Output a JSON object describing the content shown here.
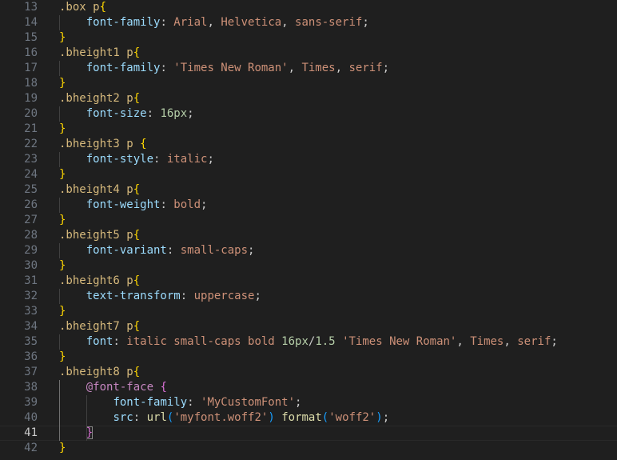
{
  "editor": {
    "language": "css",
    "current_line": 41,
    "colors": {
      "background": "#1f1f1f",
      "line_number": "#6e7681",
      "selector": "#d7ba7d",
      "brace": "#ffd700",
      "property": "#9cdcfe",
      "string_value": "#ce9178",
      "number": "#b5cea8",
      "function": "#dcdcaa"
    },
    "lines": [
      {
        "n": "13",
        "tokens": [
          {
            "t": ".box p",
            "c": "sel"
          },
          {
            "t": "{",
            "c": "brace"
          }
        ]
      },
      {
        "n": "14",
        "tokens": [
          {
            "t": "    "
          },
          {
            "t": "font-family",
            "c": "prop"
          },
          {
            "t": ": "
          },
          {
            "t": "Arial",
            "c": "val"
          },
          {
            "t": ", "
          },
          {
            "t": "Helvetica",
            "c": "val"
          },
          {
            "t": ", "
          },
          {
            "t": "sans-serif",
            "c": "val"
          },
          {
            "t": ";"
          }
        ]
      },
      {
        "n": "15",
        "tokens": [
          {
            "t": "}",
            "c": "brace"
          }
        ]
      },
      {
        "n": "16",
        "tokens": [
          {
            "t": ".bheight1 p",
            "c": "sel"
          },
          {
            "t": "{",
            "c": "brace"
          }
        ]
      },
      {
        "n": "17",
        "tokens": [
          {
            "t": "    "
          },
          {
            "t": "font-family",
            "c": "prop"
          },
          {
            "t": ": "
          },
          {
            "t": "'Times New Roman'",
            "c": "val"
          },
          {
            "t": ", "
          },
          {
            "t": "Times",
            "c": "val"
          },
          {
            "t": ", "
          },
          {
            "t": "serif",
            "c": "val"
          },
          {
            "t": ";"
          }
        ]
      },
      {
        "n": "18",
        "tokens": [
          {
            "t": "}",
            "c": "brace"
          }
        ]
      },
      {
        "n": "19",
        "tokens": [
          {
            "t": ".bheight2 p",
            "c": "sel"
          },
          {
            "t": "{",
            "c": "brace"
          }
        ]
      },
      {
        "n": "20",
        "tokens": [
          {
            "t": "    "
          },
          {
            "t": "font-size",
            "c": "prop"
          },
          {
            "t": ": "
          },
          {
            "t": "16px",
            "c": "num"
          },
          {
            "t": ";"
          }
        ]
      },
      {
        "n": "21",
        "tokens": [
          {
            "t": "}",
            "c": "brace"
          }
        ]
      },
      {
        "n": "22",
        "tokens": [
          {
            "t": ".bheight3 p ",
            "c": "sel"
          },
          {
            "t": "{",
            "c": "brace"
          }
        ]
      },
      {
        "n": "23",
        "tokens": [
          {
            "t": "    "
          },
          {
            "t": "font-style",
            "c": "prop"
          },
          {
            "t": ": "
          },
          {
            "t": "italic",
            "c": "val"
          },
          {
            "t": ";"
          }
        ]
      },
      {
        "n": "24",
        "tokens": [
          {
            "t": "}",
            "c": "brace"
          }
        ]
      },
      {
        "n": "25",
        "tokens": [
          {
            "t": ".bheight4 p",
            "c": "sel"
          },
          {
            "t": "{",
            "c": "brace"
          }
        ]
      },
      {
        "n": "26",
        "tokens": [
          {
            "t": "    "
          },
          {
            "t": "font-weight",
            "c": "prop"
          },
          {
            "t": ": "
          },
          {
            "t": "bold",
            "c": "val"
          },
          {
            "t": ";"
          }
        ]
      },
      {
        "n": "27",
        "tokens": [
          {
            "t": "}",
            "c": "brace"
          }
        ]
      },
      {
        "n": "28",
        "tokens": [
          {
            "t": ".bheight5 p",
            "c": "sel"
          },
          {
            "t": "{",
            "c": "brace"
          }
        ]
      },
      {
        "n": "29",
        "tokens": [
          {
            "t": "    "
          },
          {
            "t": "font-variant",
            "c": "prop"
          },
          {
            "t": ": "
          },
          {
            "t": "small-caps",
            "c": "val"
          },
          {
            "t": ";"
          }
        ]
      },
      {
        "n": "30",
        "tokens": [
          {
            "t": "}",
            "c": "brace"
          }
        ]
      },
      {
        "n": "31",
        "tokens": [
          {
            "t": ".bheight6 p",
            "c": "sel"
          },
          {
            "t": "{",
            "c": "brace"
          }
        ]
      },
      {
        "n": "32",
        "tokens": [
          {
            "t": "    "
          },
          {
            "t": "text-transform",
            "c": "prop"
          },
          {
            "t": ": "
          },
          {
            "t": "uppercase",
            "c": "val"
          },
          {
            "t": ";"
          }
        ]
      },
      {
        "n": "33",
        "tokens": [
          {
            "t": "}",
            "c": "brace"
          }
        ]
      },
      {
        "n": "34",
        "tokens": [
          {
            "t": ".bheight7 p",
            "c": "sel"
          },
          {
            "t": "{",
            "c": "brace"
          }
        ]
      },
      {
        "n": "35",
        "tokens": [
          {
            "t": "    "
          },
          {
            "t": "font",
            "c": "prop"
          },
          {
            "t": ": "
          },
          {
            "t": "italic small-caps bold ",
            "c": "val"
          },
          {
            "t": "16px",
            "c": "num"
          },
          {
            "t": "/"
          },
          {
            "t": "1.5",
            "c": "num"
          },
          {
            "t": " "
          },
          {
            "t": "'Times New Roman'",
            "c": "val"
          },
          {
            "t": ", "
          },
          {
            "t": "Times",
            "c": "val"
          },
          {
            "t": ", "
          },
          {
            "t": "serif",
            "c": "val"
          },
          {
            "t": ";"
          }
        ]
      },
      {
        "n": "36",
        "tokens": [
          {
            "t": "}",
            "c": "brace"
          }
        ]
      },
      {
        "n": "37",
        "tokens": [
          {
            "t": ".bheight8 p",
            "c": "sel"
          },
          {
            "t": "{",
            "c": "brace"
          }
        ]
      },
      {
        "n": "38",
        "tokens": [
          {
            "t": "    "
          },
          {
            "t": "@font-face",
            "c": "at"
          },
          {
            "t": " "
          },
          {
            "t": "{",
            "c": "brace2"
          }
        ]
      },
      {
        "n": "39",
        "tokens": [
          {
            "t": "        "
          },
          {
            "t": "font-family",
            "c": "prop"
          },
          {
            "t": ": "
          },
          {
            "t": "'MyCustomFont'",
            "c": "val"
          },
          {
            "t": ";"
          }
        ]
      },
      {
        "n": "40",
        "tokens": [
          {
            "t": "        "
          },
          {
            "t": "src",
            "c": "prop"
          },
          {
            "t": ": "
          },
          {
            "t": "url",
            "c": "func"
          },
          {
            "t": "(",
            "c": "brace3"
          },
          {
            "t": "'myfont.woff2'",
            "c": "val"
          },
          {
            "t": ")",
            "c": "brace3"
          },
          {
            "t": " "
          },
          {
            "t": "format",
            "c": "func"
          },
          {
            "t": "(",
            "c": "brace3"
          },
          {
            "t": "'woff2'",
            "c": "val"
          },
          {
            "t": ")",
            "c": "brace3"
          },
          {
            "t": ";"
          }
        ]
      },
      {
        "n": "41",
        "tokens": [
          {
            "t": "    "
          },
          {
            "t": "}",
            "c": "brace2",
            "box": true
          }
        ]
      },
      {
        "n": "42",
        "tokens": [
          {
            "t": "}",
            "c": "brace"
          }
        ]
      }
    ]
  }
}
